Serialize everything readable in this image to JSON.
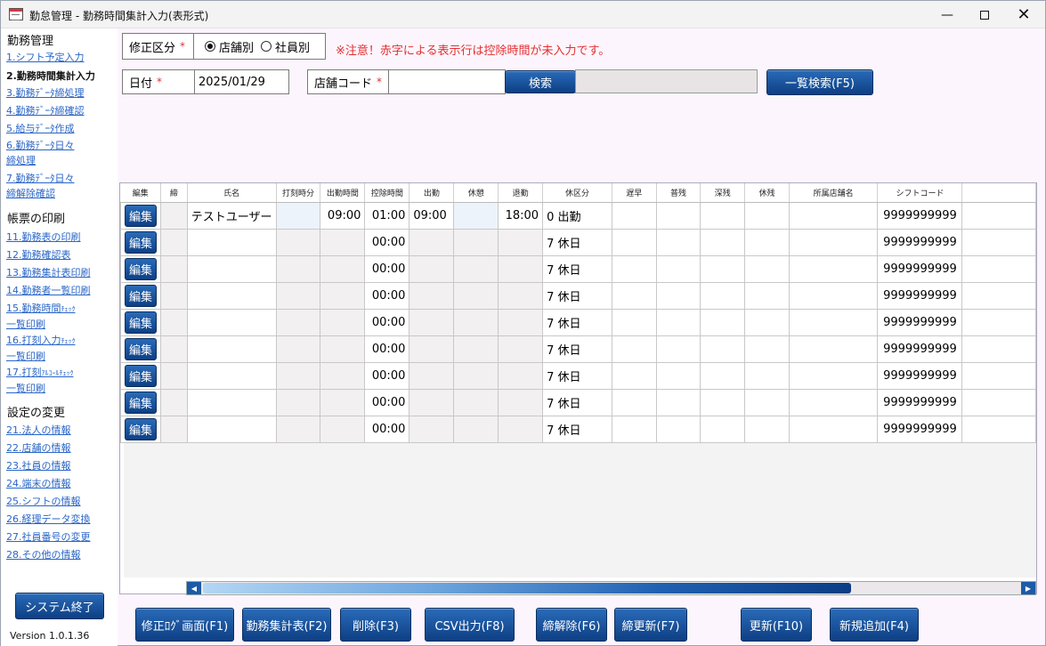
{
  "window": {
    "title": "勤怠管理 - 勤務時間集計入力(表形式)",
    "minimize_glyph": "—",
    "close_glyph": "✕"
  },
  "sidebar": {
    "sections": [
      {
        "title": "勤務管理",
        "items": [
          {
            "label": "1.シフト予定入力"
          },
          {
            "label": "2.勤務時間集計入力",
            "active": true
          },
          {
            "label": "3.勤務ﾃﾞｰﾀ締処理"
          },
          {
            "label": "4.勤務ﾃﾞｰﾀ締確認"
          },
          {
            "label": "5.給与ﾃﾞｰﾀ作成"
          },
          {
            "label": "6.勤務ﾃﾞｰﾀ日々",
            "label2": "締処理"
          },
          {
            "label": "7.勤務ﾃﾞｰﾀ日々",
            "label2": "締解除確認"
          }
        ]
      },
      {
        "title": "帳票の印刷",
        "items": [
          {
            "label": "11.勤務表の印刷"
          },
          {
            "label": "12.勤務確認表"
          },
          {
            "label": "13.勤務集計表印刷"
          },
          {
            "label": "14.勤務者一覧印刷"
          },
          {
            "label": "15.勤務時間",
            "small": "ﾁｪｯｸ",
            "label2": "一覧印刷"
          },
          {
            "label": "16.打刻入力",
            "small": "ﾁｪｯｸ",
            "label2": "一覧印刷"
          },
          {
            "label": "17.打刻",
            "small": "ｱﾙｺｰﾙﾁｪｯｸ",
            "label2": "一覧印刷"
          }
        ]
      },
      {
        "title": "設定の変更",
        "items": [
          {
            "label": "21.法人の情報"
          },
          {
            "label": "22.店舗の情報"
          },
          {
            "label": "23.社員の情報"
          },
          {
            "label": "24.端末の情報"
          },
          {
            "label": "25.シフトの情報"
          },
          {
            "label": "26.経理データ変換"
          },
          {
            "label": "27.社員番号の変更"
          },
          {
            "label": "28.その他の情報"
          }
        ]
      }
    ],
    "exit_button": "システム終了",
    "version": "Version  1.0.1.36"
  },
  "form": {
    "correction_label": "修正区分",
    "required_mark": "*",
    "radio_store": "店舗別",
    "radio_employee": "社員別",
    "notice": "※注意！赤字による表示行は控除時間が未入力です。",
    "date_label": "日付",
    "date_value": "2025/01/29",
    "store_code_label": "店舗コード",
    "store_code_value": "",
    "search_button": "検索",
    "list_search_button": "一覧検索(F5)"
  },
  "grid": {
    "columns": [
      "編集",
      "締",
      "氏名",
      "打刻時分",
      "出勤時間",
      "控除時間",
      "出勤",
      "休憩",
      "退勤",
      "休区分",
      "遅早",
      "普残",
      "深残",
      "休残",
      "所属店舗名",
      "シフトコード"
    ],
    "edit_label": "編集",
    "employee_name": "テストユーザー",
    "shift_code": "9999999999",
    "rows": [
      {
        "start_time": "09:00",
        "deduction": "01:00",
        "clock_in": "09:00",
        "clock_out": "18:00",
        "leave_code": "0",
        "leave_name": "出勤"
      },
      {
        "start_time": "",
        "deduction": "00:00",
        "clock_in": "",
        "clock_out": "",
        "leave_code": "7",
        "leave_name": "休日"
      },
      {
        "start_time": "",
        "deduction": "00:00",
        "clock_in": "",
        "clock_out": "",
        "leave_code": "7",
        "leave_name": "休日"
      },
      {
        "start_time": "",
        "deduction": "00:00",
        "clock_in": "",
        "clock_out": "",
        "leave_code": "7",
        "leave_name": "休日"
      },
      {
        "start_time": "",
        "deduction": "00:00",
        "clock_in": "",
        "clock_out": "",
        "leave_code": "7",
        "leave_name": "休日"
      },
      {
        "start_time": "",
        "deduction": "00:00",
        "clock_in": "",
        "clock_out": "",
        "leave_code": "7",
        "leave_name": "休日"
      },
      {
        "start_time": "",
        "deduction": "00:00",
        "clock_in": "",
        "clock_out": "",
        "leave_code": "7",
        "leave_name": "休日"
      },
      {
        "start_time": "",
        "deduction": "00:00",
        "clock_in": "",
        "clock_out": "",
        "leave_code": "7",
        "leave_name": "休日"
      },
      {
        "start_time": "",
        "deduction": "00:00",
        "clock_in": "",
        "clock_out": "",
        "leave_code": "7",
        "leave_name": "休日"
      }
    ]
  },
  "footer": {
    "buttons": [
      {
        "label": "修正ﾛｸﾞ画面(F1)",
        "name": "log-screen-button"
      },
      {
        "label": "勤務集計表(F2)",
        "name": "work-summary-button"
      },
      {
        "label": "削除(F3)",
        "name": "delete-button"
      },
      {
        "label": "CSV出力(F8)",
        "name": "csv-export-button"
      },
      {
        "label": "締解除(F6)",
        "name": "unlock-closing-button"
      },
      {
        "label": "締更新(F7)",
        "name": "closing-update-button"
      },
      {
        "label": "更新(F10)",
        "name": "update-button"
      },
      {
        "label": "新規追加(F4)",
        "name": "add-new-button"
      }
    ]
  }
}
